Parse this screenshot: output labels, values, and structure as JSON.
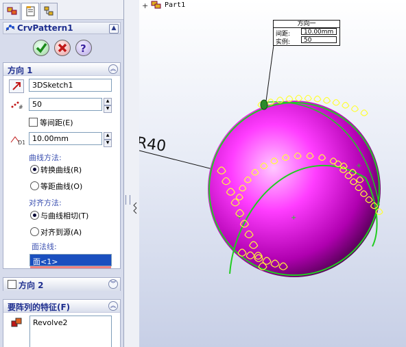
{
  "feature_name": "CrvPattern1",
  "tree_item": "Part1",
  "direction1": {
    "header": "方向 1",
    "path_ref": "3DSketch1",
    "instances": "50",
    "equal_spacing_label": "等间距(E)",
    "spacing": "10.00mm",
    "curve_method_label": "曲线方法:",
    "curve_method_options": [
      "转换曲线(R)",
      "等距曲线(O)"
    ],
    "align_method_label": "对齐方法:",
    "align_method_options": [
      "与曲线相切(T)",
      "对齐到源(A)"
    ],
    "normal_label": "面法线:",
    "normal_face": "面<1>"
  },
  "direction2": {
    "header": "方向 2"
  },
  "features_to_pattern": {
    "header": "要阵列的特征(F)",
    "items": [
      "Revolve2"
    ]
  },
  "callout": {
    "title": "方向一",
    "rows": [
      {
        "label": "间距:",
        "value": "10.00mm"
      },
      {
        "label": "实例:",
        "value": "50"
      }
    ]
  },
  "dimension": "R40",
  "colors": {
    "sphere": "#e000e0",
    "pattern": "#ffff33",
    "curve": "#22cc22",
    "accent": "#1f2f8f"
  }
}
